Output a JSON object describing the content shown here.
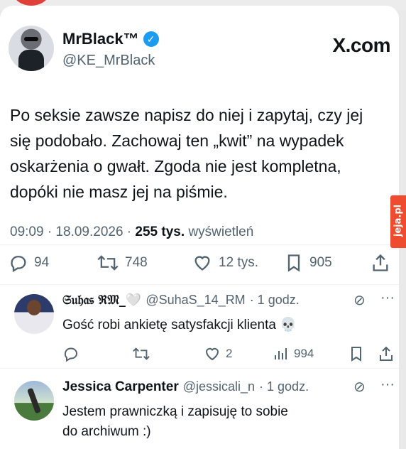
{
  "tweet": {
    "display_name": "MrBlack™",
    "handle": "@KE_MrBlack",
    "brand": "X.com",
    "text_lines": [
      "Po seksie zawsze napisz do niej i zapytaj, czy jej",
      "się podobało. Zachowaj ten „kwit” na wypadek",
      "oskarżenia o gwałt. Zgoda nie jest kompletna,",
      "dopóki nie masz jej na piśmie."
    ],
    "time": "09:09 · 18.09.2026 ·",
    "views_count": "255 tys.",
    "views_label": "wyświetleń",
    "actions": {
      "replies": "94",
      "retweets": "748",
      "likes": "12 tys.",
      "bookmarks": "905"
    }
  },
  "watermark": "jeja.pl",
  "replies": [
    {
      "name": "𝔖𝔲𝔥𝔞𝔰 ℜ𝔐_🤍",
      "handle": "@SuhaS_14_RM",
      "time": "· 1 godz.",
      "text": "Gość robi ankietę satysfakcji klienta 💀",
      "likes": "2",
      "views": "994"
    },
    {
      "name": "Jessica Carpenter",
      "handle": "@jessicali_n",
      "time": "· 1 godz.",
      "text_lines": [
        "Jestem prawniczką i zapisuję to sobie",
        "do archiwum :)"
      ]
    }
  ],
  "icons": {
    "reply": "speech-bubble-icon",
    "retweet": "retweet-icon",
    "like": "heart-icon",
    "bookmark": "bookmark-icon",
    "share": "share-icon",
    "views": "bar-chart-icon",
    "grok": "slashed-circle-icon",
    "more": "more-dots-icon",
    "verified": "verified-badge-icon"
  },
  "colors": {
    "accent_blue": "#1d9bf0",
    "text": "#0f1419",
    "muted": "#536471",
    "watermark_bg": "#ef4b2f"
  }
}
